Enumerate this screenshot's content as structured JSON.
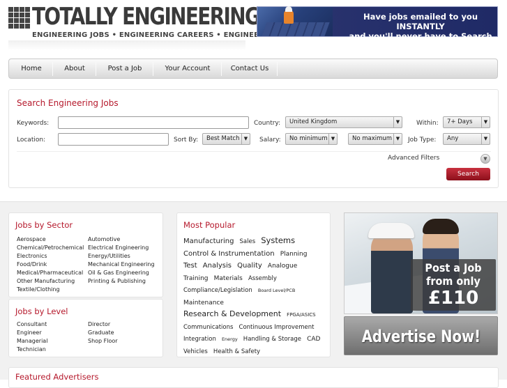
{
  "header": {
    "logo_title": "TOTALLY ENGINEERING",
    "logo_tagline": "ENGINEERING JOBS • ENGINEERING CAREERS • ENGINEERING SUCCESS",
    "banner_line1": "Have jobs emailed to you INSTANTLY",
    "banner_line2": "and you'll never have to Search again"
  },
  "nav": {
    "items": [
      "Home",
      "About",
      "Post a Job",
      "Your Account",
      "Contact Us"
    ]
  },
  "search": {
    "title": "Search Engineering Jobs",
    "keywords_label": "Keywords:",
    "keywords_value": "",
    "country_label": "Country:",
    "country_value": "United Kingdom",
    "within_label": "Within:",
    "within_value": "7+ Days",
    "location_label": "Location:",
    "location_value": "",
    "sortby_label": "Sort By:",
    "sortby_value": "Best Match",
    "salary_label": "Salary:",
    "salary_min": "No minimum",
    "salary_max": "No maximum",
    "jobtype_label": "Job Type:",
    "jobtype_value": "Any",
    "advanced_filters": "Advanced Filters",
    "search_button": "Search"
  },
  "sector": {
    "title": "Jobs by Sector",
    "col1": [
      "Aerospace",
      "Chemical/Petrochemical",
      "Electronics",
      "Food/Drink",
      "Medical/Pharmaceutical",
      "Other Manufacturing",
      "Textile/Clothing"
    ],
    "col2": [
      "Automotive",
      "Electrical Engineering",
      "Energy/Utilities",
      "Mechanical Engineering",
      "Oil & Gas Engineering",
      "Printing & Publishing"
    ]
  },
  "level": {
    "title": "Jobs by Level",
    "col1": [
      "Consultant",
      "Engineer",
      "Managerial",
      "Technician"
    ],
    "col2": [
      "Director",
      "Graduate",
      "Shop Floor"
    ]
  },
  "popular": {
    "title": "Most Popular",
    "tags": [
      {
        "text": "Manufacturing",
        "size": 10
      },
      {
        "text": "Sales",
        "size": 8.5
      },
      {
        "text": "Systems",
        "size": 11.5
      },
      {
        "text": "Control & Instrumentation",
        "size": 10
      },
      {
        "text": "Planning",
        "size": 9
      },
      {
        "text": "Test",
        "size": 10
      },
      {
        "text": "Analysis",
        "size": 10
      },
      {
        "text": "Quality",
        "size": 10
      },
      {
        "text": "Analogue",
        "size": 9
      },
      {
        "text": "Training",
        "size": 9
      },
      {
        "text": "Materials",
        "size": 9
      },
      {
        "text": "Assembly",
        "size": 8.5
      },
      {
        "text": "Compliance/Legislation",
        "size": 8.5
      },
      {
        "text": "Board Level/PCB",
        "size": 6.5
      },
      {
        "text": "Maintenance",
        "size": 9
      },
      {
        "text": "Research & Development",
        "size": 11
      },
      {
        "text": "FPGA/ASICS",
        "size": 7
      },
      {
        "text": "Communications",
        "size": 8.5
      },
      {
        "text": "Continuous Improvement",
        "size": 8.5
      },
      {
        "text": "Integration",
        "size": 8.5
      },
      {
        "text": "Energy",
        "size": 6.5
      },
      {
        "text": "Handling & Storage",
        "size": 8.5
      },
      {
        "text": "CAD",
        "size": 9
      },
      {
        "text": "Vehicles",
        "size": 8.5
      },
      {
        "text": "Health & Safety",
        "size": 8.5
      }
    ]
  },
  "promo": {
    "postjob_line1": "Post a Job",
    "postjob_line2": "from only",
    "postjob_price": "£110",
    "advertise": "Advertise Now!"
  },
  "featured": {
    "title": "Featured Advertisers"
  }
}
